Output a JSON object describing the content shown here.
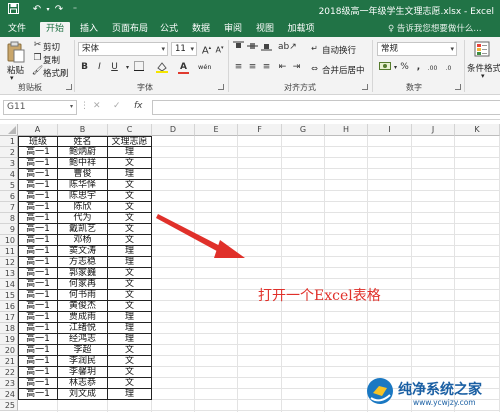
{
  "window": {
    "title": "2018级高一年级学生文理志愿.xlsx - Excel",
    "quick_access": [
      "save-icon",
      "undo-icon",
      "redo-icon",
      "customize-icon"
    ]
  },
  "tabs": [
    {
      "label": "文件"
    },
    {
      "label": "开始",
      "active": true
    },
    {
      "label": "插入"
    },
    {
      "label": "页面布局"
    },
    {
      "label": "公式"
    },
    {
      "label": "数据"
    },
    {
      "label": "审阅"
    },
    {
      "label": "视图"
    },
    {
      "label": "加载项"
    }
  ],
  "help_search": "♀ 告诉我您想要做什么...",
  "ribbon": {
    "clipboard": {
      "paste": "粘贴",
      "cut": "剪切",
      "copy": "复制",
      "format_painter": "格式刷",
      "group_label": "剪贴板"
    },
    "font": {
      "name": "宋体",
      "size": "11",
      "bold": "B",
      "italic": "I",
      "underline": "U",
      "font_color_glyph": "A",
      "wen": "wén",
      "group_label": "字体"
    },
    "alignment": {
      "wrap_text": "自动换行",
      "merge_center": "合并后居中",
      "group_label": "对齐方式"
    },
    "number": {
      "format": "常规",
      "percent": "%",
      "comma": ",",
      "group_label": "数字"
    },
    "styles": {
      "conditional_format": "条件格式"
    }
  },
  "formula_bar": {
    "name_box": "G11",
    "cancel": "✕",
    "enter": "✓",
    "fx": "fx",
    "value": ""
  },
  "sheet": {
    "columns": [
      "A",
      "B",
      "C",
      "D",
      "E",
      "F",
      "G",
      "H",
      "I",
      "J",
      "K"
    ],
    "row_numbers": [
      "1",
      "2",
      "3",
      "4",
      "5",
      "6",
      "7",
      "8",
      "9",
      "10",
      "11",
      "12",
      "13",
      "14",
      "15",
      "16",
      "17",
      "18",
      "19",
      "20",
      "21",
      "22",
      "23",
      "24",
      "25"
    ],
    "rows": [
      [
        "班级",
        "姓名",
        "文理志愿"
      ],
      [
        "高一1",
        "鲍炳蔚",
        "理"
      ],
      [
        "高一1",
        "鲍中祥",
        "文"
      ],
      [
        "高一1",
        "曹俊",
        "理"
      ],
      [
        "高一1",
        "陈华怿",
        "文"
      ],
      [
        "高一1",
        "陈思宇",
        "文"
      ],
      [
        "高一1",
        "陈欣",
        "文"
      ],
      [
        "高一1",
        "代为",
        "文"
      ],
      [
        "高一1",
        "戴凯艺",
        "文"
      ],
      [
        "高一1",
        "邓杨",
        "文"
      ],
      [
        "高一1",
        "窦文涛",
        "理"
      ],
      [
        "高一1",
        "方志稳",
        "理"
      ],
      [
        "高一1",
        "郭家巍",
        "文"
      ],
      [
        "高一1",
        "何家再",
        "文"
      ],
      [
        "高一1",
        "何书雨",
        "文"
      ],
      [
        "高一1",
        "黄俊杰",
        "文"
      ],
      [
        "高一1",
        "贾成雨",
        "理"
      ],
      [
        "高一1",
        "江绪悦",
        "理"
      ],
      [
        "高一1",
        "经鸿志",
        "理"
      ],
      [
        "高一1",
        "李超",
        "文"
      ],
      [
        "高一1",
        "李润民",
        "文"
      ],
      [
        "高一1",
        "李馨玥",
        "文"
      ],
      [
        "高一1",
        "林志恭",
        "文"
      ],
      [
        "高一1",
        "刘文成",
        "理"
      ]
    ]
  },
  "annotation": "打开一个Excel表格",
  "colors": {
    "excel_green": "#217346",
    "annotation_red": "#e0302a"
  },
  "watermark": {
    "brand": "纯净系统之家",
    "url": "www.ycwjzy.com"
  }
}
